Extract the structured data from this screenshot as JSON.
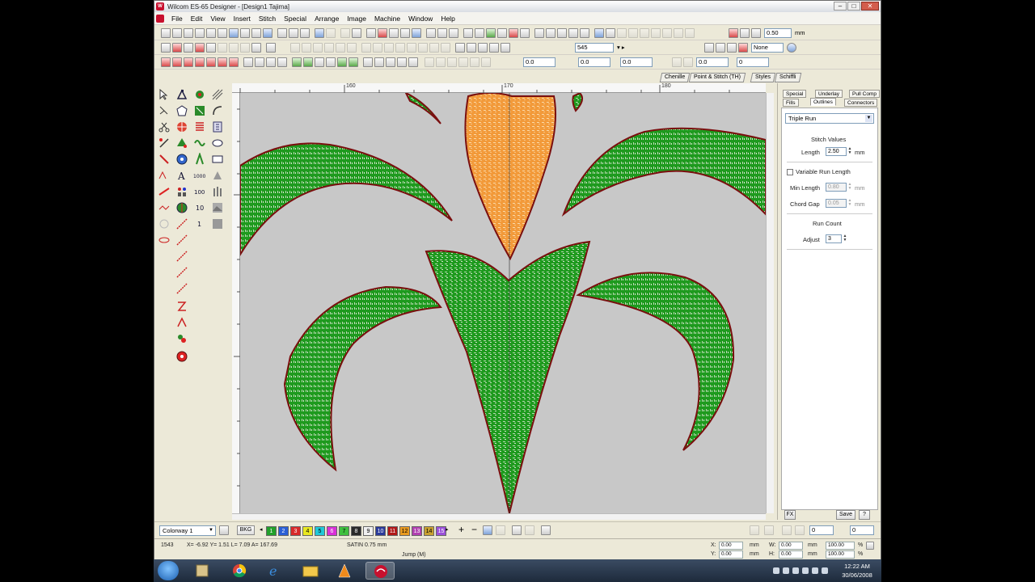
{
  "window": {
    "title": "Wilcom ES-65 Designer - [Design1      Tajima]"
  },
  "menu": [
    "File",
    "Edit",
    "View",
    "Insert",
    "Stitch",
    "Special",
    "Arrange",
    "Image",
    "Machine",
    "Window",
    "Help"
  ],
  "toolbar": {
    "zoom_value": "0.50",
    "zoom_unit": "mm",
    "density_value": "545",
    "color_mode": "None",
    "row3_field1": "0.0",
    "row3_field2": "0.0",
    "row3_field3": "0.0",
    "row3_field4": "0.0",
    "row3_field5": "0"
  },
  "object_tabs": [
    "Chenille",
    "Point & Stitch (TH)",
    "Styles",
    "Schiffli"
  ],
  "rulers": {
    "h_labels": [
      "160",
      "170",
      "180"
    ]
  },
  "properties": {
    "tabs_row1": [
      "Special",
      "Underlay",
      "Pull Comp"
    ],
    "tabs_row2": [
      "Fills",
      "Outlines",
      "Connectors"
    ],
    "active_tab": "Outlines",
    "outline_type": "Triple Run",
    "stitch_values_label": "Stitch Values",
    "length_label": "Length",
    "length_value": "2.50",
    "length_unit": "mm",
    "variable_run_label": "Variable Run Length",
    "min_length_label": "Min Length",
    "min_length_value": "0.80",
    "min_length_unit": "mm",
    "chord_gap_label": "Chord Gap",
    "chord_gap_value": "0.05",
    "chord_gap_unit": "mm",
    "run_count_label": "Run Count",
    "adjust_label": "Adjust",
    "adjust_value": "3",
    "fx_label": "FX",
    "save_label": "Save",
    "help_label": "?"
  },
  "colorway": {
    "selected": "Colorway 1",
    "bkg_label": "BKG",
    "swatches": [
      {
        "label": "1",
        "color": "#22a02a"
      },
      {
        "label": "2",
        "color": "#2b5fd6"
      },
      {
        "label": "3",
        "color": "#d82a2a"
      },
      {
        "label": "4",
        "color": "#e8e820"
      },
      {
        "label": "5",
        "color": "#20c8d8"
      },
      {
        "label": "6",
        "color": "#d830d8"
      },
      {
        "label": "7",
        "color": "#40c040"
      },
      {
        "label": "8",
        "color": "#2a2a2a"
      },
      {
        "label": "9",
        "color": "#f0f0f0"
      },
      {
        "label": "10",
        "color": "#2a3a9a"
      },
      {
        "label": "11",
        "color": "#b01818"
      },
      {
        "label": "12",
        "color": "#e89a20"
      },
      {
        "label": "13",
        "color": "#b040b0"
      },
      {
        "label": "14",
        "color": "#c8a030"
      },
      {
        "label": "15",
        "color": "#9a50d8"
      }
    ]
  },
  "status": {
    "stitch_count": "1543",
    "coords": "X= -6.92 Y=  1.51 L=   7.09 A= 167.69",
    "stitch_type": "SATIN  0.75 mm",
    "jump": "Jump (M)",
    "x_label": "X:",
    "x_value": "0.00",
    "y_label": "Y:",
    "y_value": "0.00",
    "w_label": "W:",
    "w_value": "0.00",
    "h_label": "H:",
    "h_value": "0.00",
    "unit_mm": "mm",
    "pct1": "100.00",
    "pct2": "100.00",
    "pct_sign": "%"
  },
  "panel_misc": {
    "spin_value": "0",
    "spin_value2": "0"
  },
  "taskbar": {
    "time": "12:22 AM",
    "date": "30/06/2008"
  },
  "colors": {
    "canvas": "#c8c8c8",
    "fill_green": "#1e9a1e",
    "fill_orange": "#f29a3a",
    "outline_red": "#8a1010",
    "accent": "#c8102e"
  }
}
